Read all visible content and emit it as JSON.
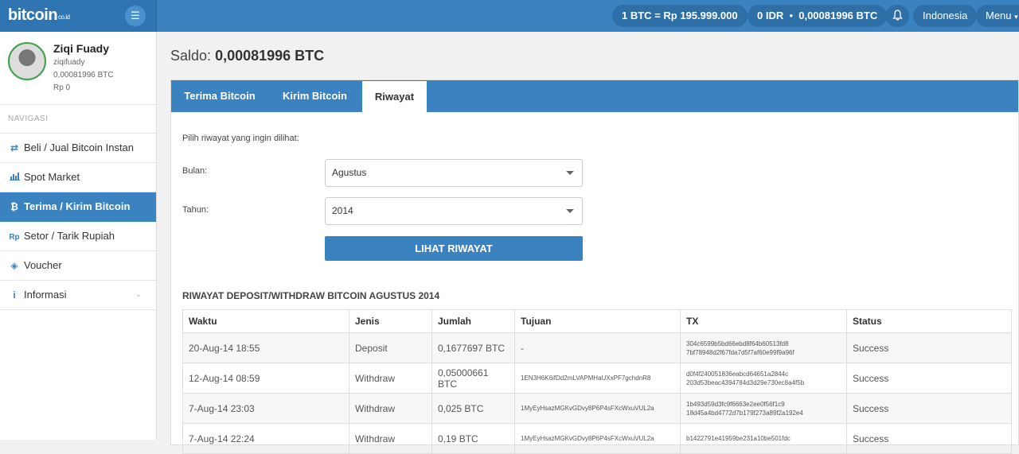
{
  "header": {
    "logo_main": "bitcoin",
    "logo_sub": "co.id",
    "rate": "1 BTC = Rp 195.999.000",
    "balance_idr": "0 IDR",
    "balance_btc": "0,00081996 BTC",
    "language": "Indonesia",
    "menu_label": "Menu"
  },
  "sidebar": {
    "user_name": "Ziqi Fuady",
    "username": "ziqifuady",
    "btc_balance": "0,00081996 BTC",
    "rp_balance": "Rp 0",
    "nav_heading": "NAVIGASI",
    "items": [
      {
        "label": "Beli / Jual Bitcoin Instan",
        "icon": "exchange-icon"
      },
      {
        "label": "Spot Market",
        "icon": "bar-chart-icon"
      },
      {
        "label": "Terima / Kirim Bitcoin",
        "icon": "bitcoin-icon",
        "active": true
      },
      {
        "label": "Setor / Tarik Rupiah",
        "icon": "rupiah-icon"
      },
      {
        "label": "Voucher",
        "icon": "tag-icon"
      },
      {
        "label": "Informasi",
        "icon": "info-icon"
      }
    ]
  },
  "main": {
    "saldo_label": "Saldo:",
    "saldo_value": "0,00081996 BTC",
    "tabs": [
      "Terima Bitcoin",
      "Kirim Bitcoin",
      "Riwayat"
    ],
    "active_tab": "Riwayat",
    "form": {
      "intro": "Pilih riwayat yang ingin dilihat:",
      "month_label": "Bulan:",
      "month_value": "Agustus",
      "year_label": "Tahun:",
      "year_value": "2014",
      "button_label": "LIHAT RIWAYAT"
    },
    "history_title": "RIWAYAT DEPOSIT/WITHDRAW BITCOIN AGUSTUS 2014",
    "table": {
      "headers": [
        "Waktu",
        "Jenis",
        "Jumlah",
        "Tujuan",
        "TX",
        "Status"
      ],
      "rows": [
        {
          "waktu": "20-Aug-14 18:55",
          "jenis": "Deposit",
          "jumlah": "0,1677697 BTC",
          "tujuan": "-",
          "tx1": "304c6599b5bd66ebd8f64b60513fd8",
          "tx2": "7bf78948d2f67fda7d5f7af60e99f9a96f",
          "status": "Success"
        },
        {
          "waktu": "12-Aug-14 08:59",
          "jenis": "Withdraw",
          "jumlah": "0,05000661 BTC",
          "tujuan": "1EN3H6K6ifDd2mLVAPMHaUXxPF7gchdnR8",
          "tx1": "d0f4f240051836eabcd64651a2844c",
          "tx2": "203d53beac4394784d3d29e730ec8a4f5b",
          "status": "Success"
        },
        {
          "waktu": "7-Aug-14 23:03",
          "jenis": "Withdraw",
          "jumlah": "0,025 BTC",
          "tujuan": "1MyEyHsazMGKvGDvy8P6P4sFXcWxuVUL2a",
          "tx1": "1b493d59d3fc9f6663e2ee0f56f1c9",
          "tx2": "18d45a4bd4772d7b179f273a89f2a192e4",
          "status": "Success"
        },
        {
          "waktu": "7-Aug-14 22:24",
          "jenis": "Withdraw",
          "jumlah": "0,19 BTC",
          "tujuan": "1MyEyHsazMGKvGDvy8P6P4sFXcWxuVUL2a",
          "tx1": "b1422791e41959be231a10be501fdc",
          "tx2": "",
          "status": "Success"
        }
      ]
    }
  }
}
